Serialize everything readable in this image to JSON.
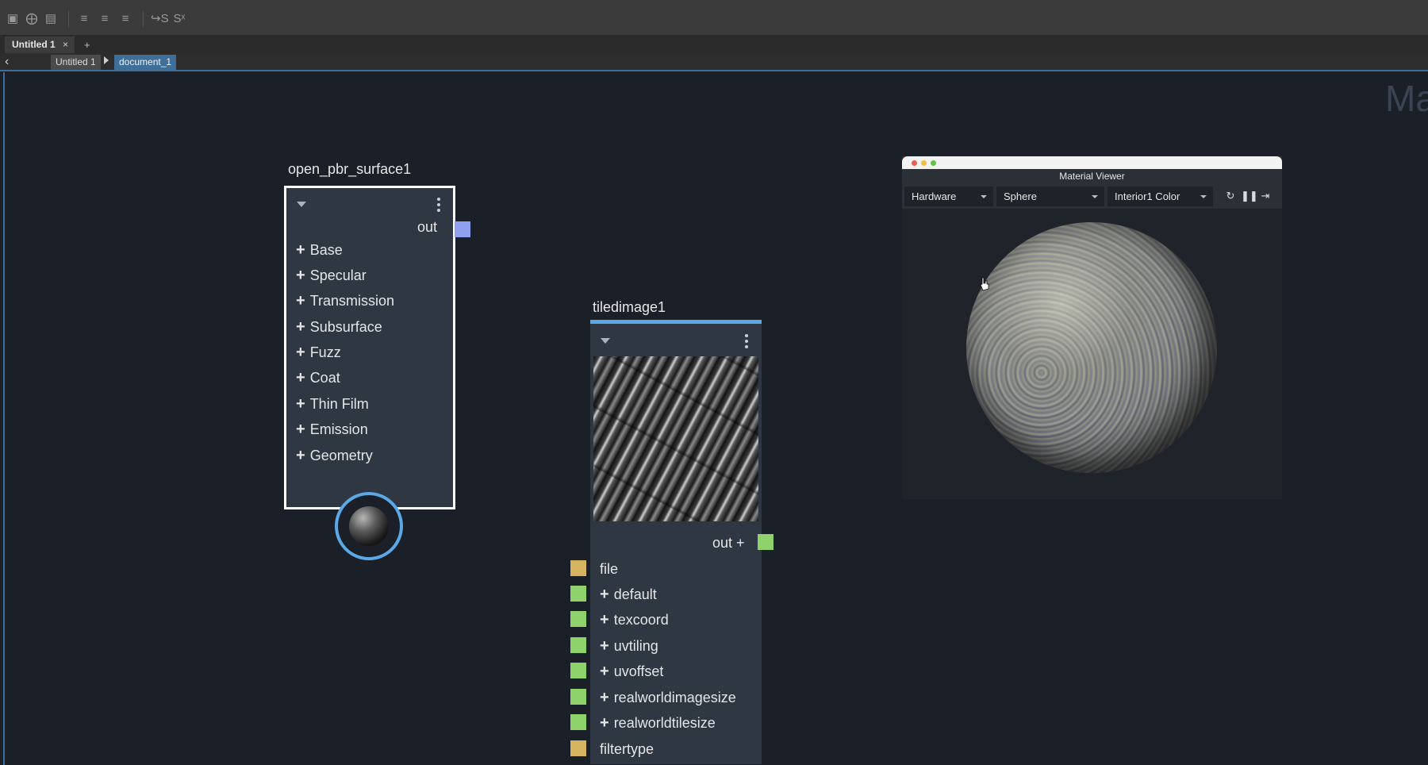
{
  "tabs": {
    "active_label": "Untitled 1",
    "close": "×",
    "add": "+"
  },
  "breadcrumb": {
    "back": "‹",
    "items": [
      "Untitled 1",
      "document_1"
    ]
  },
  "canvas": {
    "watermark": "Ma"
  },
  "pbr_node": {
    "title": "open_pbr_surface1",
    "output_label": "out",
    "output_color": "#8ea0ee",
    "groups": [
      "Base",
      "Specular",
      "Transmission",
      "Subsurface",
      "Fuzz",
      "Coat",
      "Thin Film",
      "Emission",
      "Geometry"
    ],
    "plus": "+"
  },
  "tiled_node": {
    "title": "tiledimage1",
    "output_label": "out +",
    "output_color": "#8fd16a",
    "inputs": [
      {
        "label": "file",
        "color": "#d4b45f",
        "expandable": false
      },
      {
        "label": "default",
        "color": "#8fd16a",
        "expandable": true
      },
      {
        "label": "texcoord",
        "color": "#8fd16a",
        "expandable": true
      },
      {
        "label": "uvtiling",
        "color": "#8fd16a",
        "expandable": true
      },
      {
        "label": "uvoffset",
        "color": "#8fd16a",
        "expandable": true
      },
      {
        "label": "realworldimagesize",
        "color": "#8fd16a",
        "expandable": true
      },
      {
        "label": "realworldtilesize",
        "color": "#8fd16a",
        "expandable": true
      },
      {
        "label": "filtertype",
        "color": "#d4b45f",
        "expandable": false
      }
    ]
  },
  "material_viewer": {
    "title": "Material Viewer",
    "renderer": "Hardware",
    "geometry": "Sphere",
    "environment": "Interior1 Color",
    "icons": [
      "refresh-camera-icon",
      "pause-icon",
      "export-icon"
    ]
  },
  "colors": {
    "accent": "#3f6f98",
    "selection_ring": "#5aa9e6"
  }
}
